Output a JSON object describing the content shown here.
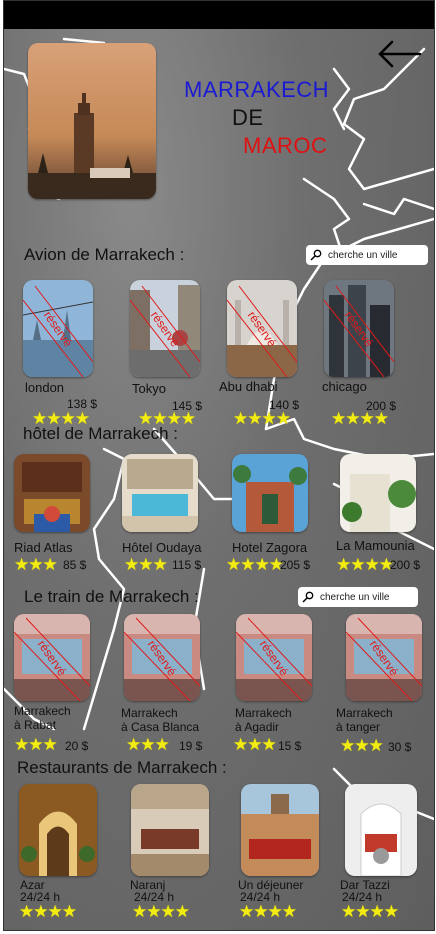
{
  "header": {
    "title_line1": "MARRAKECH",
    "title_line2": "DE",
    "title_line3": "MAROC",
    "colors": {
      "line1": "#1a1ad4",
      "line2": "#111111",
      "line3": "#e01010"
    },
    "back_icon": "arrow-left-icon"
  },
  "search_placeholder_1": "cherche un ville",
  "search_placeholder_2": "cherche un ville",
  "reserve_label": "réservé",
  "sections": {
    "avion": {
      "title": "Avion de Marrakech  :",
      "items": [
        {
          "name": "london",
          "price": "138 $",
          "stars": "★★★★",
          "reserved": true
        },
        {
          "name": "Tokyo",
          "price": "145 $",
          "stars": "★★★★",
          "reserved": true
        },
        {
          "name": "Abu dhabi",
          "price": "140 $",
          "stars": "★★★★",
          "reserved": true
        },
        {
          "name": "chicago",
          "price": "200 $",
          "stars": "★★★★",
          "reserved": true
        }
      ]
    },
    "hotel": {
      "title": "hôtel de Marrakech  :",
      "items": [
        {
          "name": "Riad Atlas",
          "price": "85 $",
          "stars": "★★★"
        },
        {
          "name": "Hôtel Oudaya",
          "price": "115 $",
          "stars": "★★★"
        },
        {
          "name": "Hotel Zagora",
          "price": "205 $",
          "stars": "★★★★"
        },
        {
          "name": "La Mamounia",
          "price": "200 $",
          "stars": "★★★★"
        }
      ]
    },
    "train": {
      "title": "Le train de Marrakech  :",
      "items": [
        {
          "line1": "Marrakech",
          "line2": "à Rabat",
          "price": "20 $",
          "stars": "★★★"
        },
        {
          "line1": "Marrakech",
          "line2": "à Casa Blanca",
          "price": "19 $",
          "stars": "★★★"
        },
        {
          "line1": "Marrakech",
          "line2": "à Agadir",
          "price": "15 $",
          "stars": "★★★"
        },
        {
          "line1": "Marrakech",
          "line2": "à tanger",
          "price": "30 $",
          "stars": "★★★"
        }
      ]
    },
    "restaurants": {
      "title": "Restaurants de Marrakech  :",
      "items": [
        {
          "name": "Azar",
          "hours": "24/24 h",
          "stars": "★★★★"
        },
        {
          "name": "Naranj",
          "hours": "24/24 h",
          "stars": "★★★★"
        },
        {
          "name": "Un déjeuner",
          "hours": "24/24 h",
          "stars": "★★★★"
        },
        {
          "name": "Dar Tazzi",
          "hours": "24/24 h",
          "stars": "★★★★"
        }
      ]
    }
  }
}
